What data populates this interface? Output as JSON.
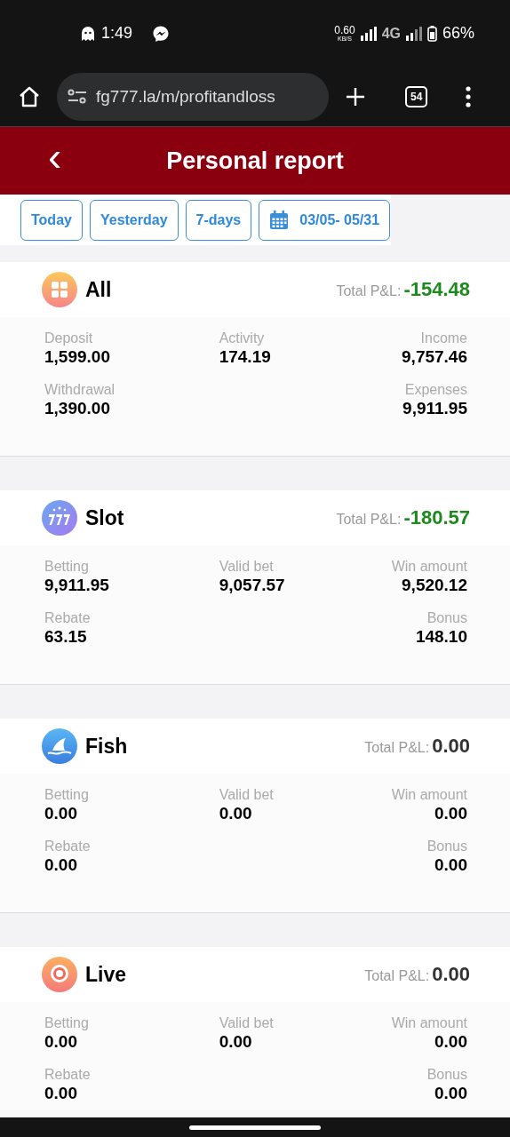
{
  "status_bar": {
    "time": "1:49",
    "speed": "0.60",
    "speed_unit": "KB/S",
    "network": "4G",
    "battery": "66%"
  },
  "browser": {
    "url": "fg777.la/m/profitandloss",
    "tab_count": "54"
  },
  "header": {
    "back": "‹",
    "title": "Personal report"
  },
  "filters": [
    {
      "label": "Today",
      "kind": "text"
    },
    {
      "label": "Yesterday",
      "kind": "text"
    },
    {
      "label": "7-days",
      "kind": "text"
    },
    {
      "label": "03/05- 05/31",
      "kind": "date"
    }
  ],
  "sections": [
    {
      "name": "All",
      "pnl_label": "Total P&L:",
      "pnl": "-154.48",
      "color": "#1e8a1e",
      "stats": [
        {
          "label": "Deposit",
          "value": "1,599.00"
        },
        {
          "label": "Activity",
          "value": "174.19"
        },
        {
          "label": "Income",
          "value": "9,757.46"
        },
        {
          "label": "Withdrawal",
          "value": "1,390.00"
        },
        {
          "label": "Expenses",
          "value": "9,911.95"
        }
      ]
    },
    {
      "name": "Slot",
      "pnl_label": "Total P&L:",
      "pnl": "-180.57",
      "color": "#1e8a1e",
      "stats": [
        {
          "label": "Betting",
          "value": "9,911.95"
        },
        {
          "label": "Valid bet",
          "value": "9,057.57"
        },
        {
          "label": "Win amount",
          "value": "9,520.12"
        },
        {
          "label": "Rebate",
          "value": "63.15"
        },
        {
          "label": "Bonus",
          "value": "148.10"
        }
      ]
    },
    {
      "name": "Fish",
      "pnl_label": "Total P&L:",
      "pnl": "0.00",
      "color": "#333333",
      "stats": [
        {
          "label": "Betting",
          "value": "0.00"
        },
        {
          "label": "Valid bet",
          "value": "0.00"
        },
        {
          "label": "Win amount",
          "value": "0.00"
        },
        {
          "label": "Rebate",
          "value": "0.00"
        },
        {
          "label": "Bonus",
          "value": "0.00"
        }
      ]
    },
    {
      "name": "Live",
      "pnl_label": "Total P&L:",
      "pnl": "0.00",
      "color": "#333333",
      "stats": [
        {
          "label": "Betting",
          "value": "0.00"
        },
        {
          "label": "Valid bet",
          "value": "0.00"
        },
        {
          "label": "Win amount",
          "value": "0.00"
        },
        {
          "label": "Rebate",
          "value": "0.00"
        },
        {
          "label": "Bonus",
          "value": "0.00"
        }
      ]
    }
  ]
}
